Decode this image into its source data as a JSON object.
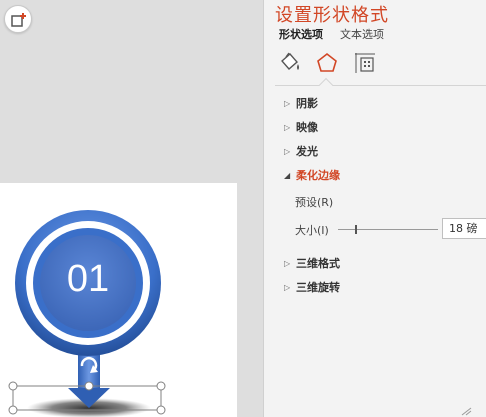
{
  "canvas": {
    "number_text": "01",
    "ring_color": "#3a6fc9",
    "inner_circle_color": "#4472c4"
  },
  "pane": {
    "title": "设置形状格式",
    "tabs": [
      {
        "label": "形状选项",
        "active": true
      },
      {
        "label": "文本选项",
        "active": false
      }
    ],
    "category_icons": [
      "fill-bucket-icon",
      "pentagon-effects-icon",
      "size-properties-icon"
    ],
    "accent_color": "#d24726",
    "sections": [
      {
        "label": "阴影",
        "expanded": false
      },
      {
        "label": "映像",
        "expanded": false
      },
      {
        "label": "发光",
        "expanded": false
      },
      {
        "label": "柔化边缘",
        "expanded": true
      },
      {
        "label": "三维格式",
        "expanded": false
      },
      {
        "label": "三维旋转",
        "expanded": false
      }
    ],
    "soft_edges": {
      "preset_label": "预设(R)",
      "size_label": "大小(I)",
      "size_value": "18 磅"
    }
  }
}
